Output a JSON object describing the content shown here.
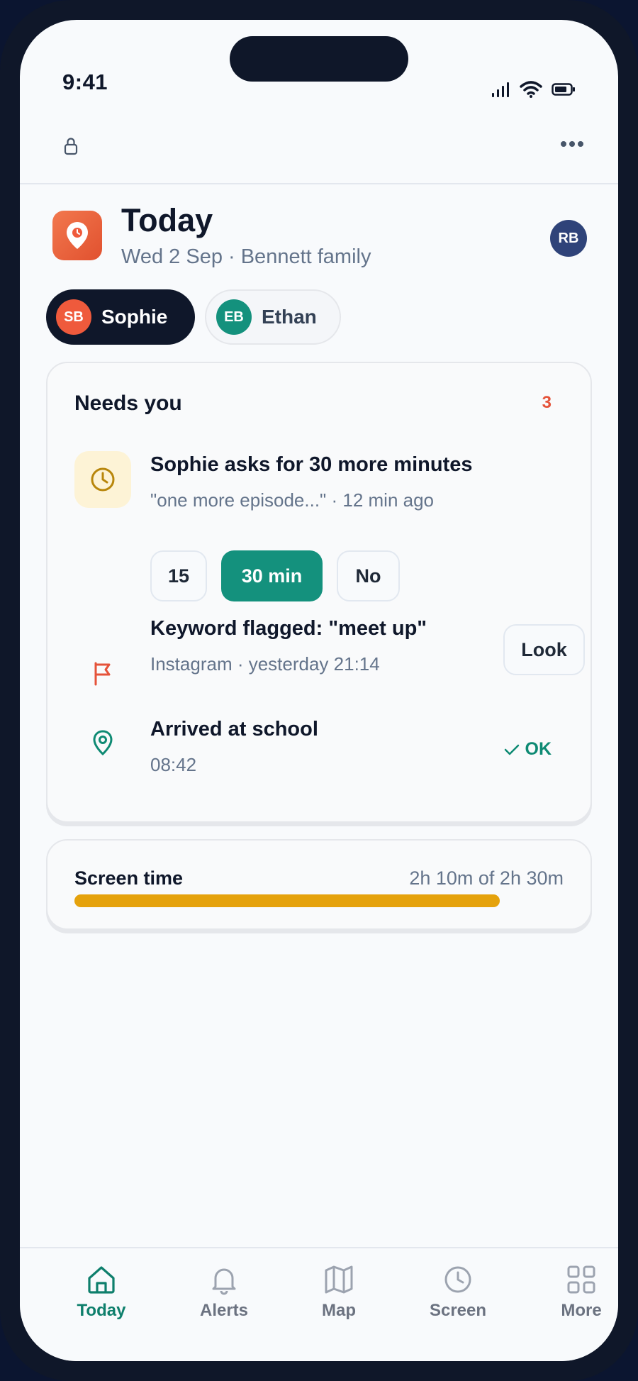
{
  "status": {
    "time": "9:41"
  },
  "header": {
    "title": "Today",
    "subtitle": "Wed 2 Sep · Bennett family",
    "user_initials": "RB"
  },
  "children": [
    {
      "initials": "SB",
      "name": "Sophie",
      "color": "#ef5a3c",
      "active": true
    },
    {
      "initials": "EB",
      "name": "Ethan",
      "color": "#14917d",
      "active": false
    }
  ],
  "needs": {
    "title": "Needs you",
    "count": "3",
    "request": {
      "title": "Sophie asks for 30 more minutes",
      "sub": "\"one more episode...\" · 12 min ago",
      "options": [
        "15",
        "30 min",
        "No"
      ]
    },
    "keyword": {
      "title": "Keyword flagged: \"meet up\"",
      "sub": "Instagram · yesterday 21:14",
      "action": "Look"
    },
    "arrival": {
      "title": "Arrived at school",
      "sub": "08:42",
      "status": "OK"
    }
  },
  "screen_time": {
    "label": "Screen time",
    "value": "2h 10m of 2h 30m",
    "fraction": 0.867,
    "color": "#e5a20c"
  },
  "tabs": [
    {
      "label": "Today",
      "icon": "home-icon",
      "active": true
    },
    {
      "label": "Alerts",
      "icon": "bell-icon",
      "active": false
    },
    {
      "label": "Map",
      "icon": "map-icon",
      "active": false
    },
    {
      "label": "Screen",
      "icon": "clock-icon",
      "active": false
    },
    {
      "label": "More",
      "icon": "grid-icon",
      "active": false
    }
  ],
  "colors": {
    "accent": "#14917d",
    "alert": "#e5533a",
    "brand": "#ef6a44"
  }
}
